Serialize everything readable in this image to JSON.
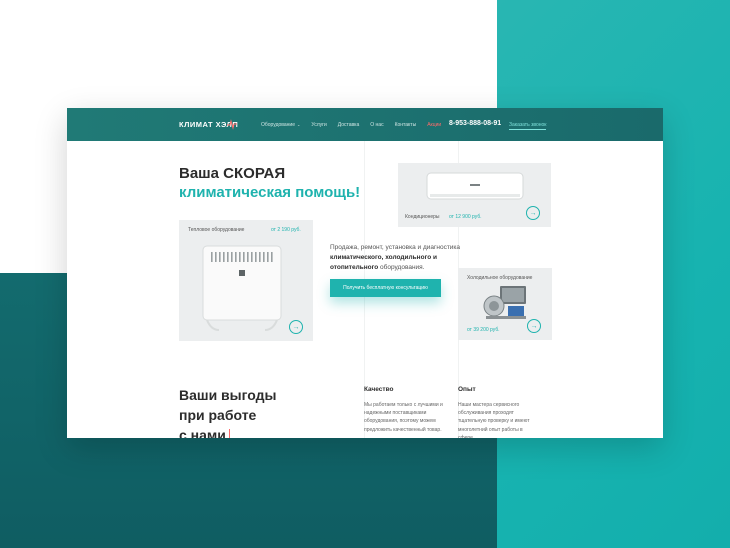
{
  "header": {
    "logo": "КЛИМАТ ХЭЛП",
    "nav": [
      "Оборудование",
      "Услуги",
      "Доставка",
      "О нас",
      "Контакты",
      "Акции"
    ],
    "phone": "8-953-888-08-91",
    "callback": "Заказать звонок"
  },
  "hero": {
    "title_line1": "Ваша СКОРАЯ",
    "title_line2": "климатическая помощь!",
    "desc_pre": "Продажа, ремонт, установка и диагностика",
    "desc_bold": "климатического, холодильного и отопительного",
    "desc_post": "оборудования.",
    "cta": "Получить бесплатную консультацию"
  },
  "cards": {
    "heat": {
      "label": "Тепловое оборудование",
      "price": "от 2 190 руб."
    },
    "ac": {
      "label": "Кондиционеры",
      "price": "от 12 900 руб."
    },
    "cold": {
      "label": "Холодильное оборудование",
      "price": "от 39 200 руб."
    }
  },
  "benefits": {
    "title_line1": "Ваши выгоды",
    "title_line2": "при работе",
    "title_line3": "с нами",
    "items": [
      {
        "title": "Качество",
        "text": "Мы работаем только с лучшими и надежными поставщиками оборудования, поэтому можем предложить качественный товар."
      },
      {
        "title": "Опыт",
        "text": "Наши мастера сервисного обслуживания проходят тщательную проверку и имеют многолетний опыт работы в сфере"
      }
    ]
  },
  "icons": {
    "arrow": "arrow-right-icon",
    "caret": "chevron-down-icon"
  },
  "colors": {
    "accent": "#1fb3ae",
    "header": "#1a6a6b",
    "highlight": "#ff6a6a",
    "dark_bg": "#136b6e"
  }
}
